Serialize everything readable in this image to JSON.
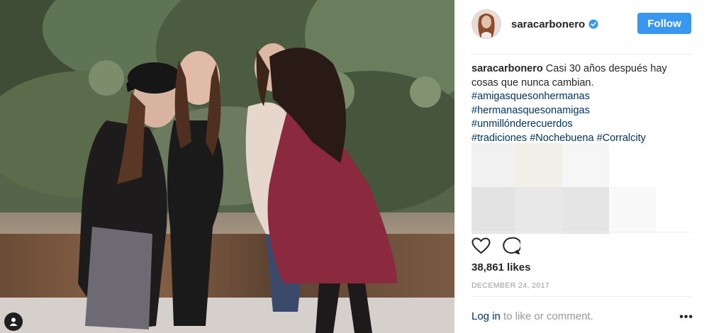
{
  "post": {
    "username": "saracarbonero",
    "follow_label": "Follow",
    "caption": {
      "username": "saracarbonero",
      "text": "Casi 30 años después hay cosas que nunca cambian.",
      "hashtags_line1": "#amigasquesonhermanas",
      "hashtags_line2": "#hermanasquesonamigas",
      "hashtags_line3": "#unmillónderecuerdos",
      "hashtags_line4a": "#tradiciones",
      "hashtags_line4b": "#Nochebuena",
      "hashtags_line4c": "#Corralcity"
    },
    "likes": "38,861 likes",
    "date": "DECEMBER 24, 2017",
    "login_link": "Log in",
    "login_text": " to like or comment.",
    "more_label": "•••"
  },
  "colors": {
    "accent": "#3897f0",
    "hashtag": "#003569",
    "muted": "#999999"
  },
  "icons": [
    "verified-badge-icon",
    "heart-icon",
    "comment-icon",
    "user-tag-icon",
    "more-options-icon"
  ]
}
